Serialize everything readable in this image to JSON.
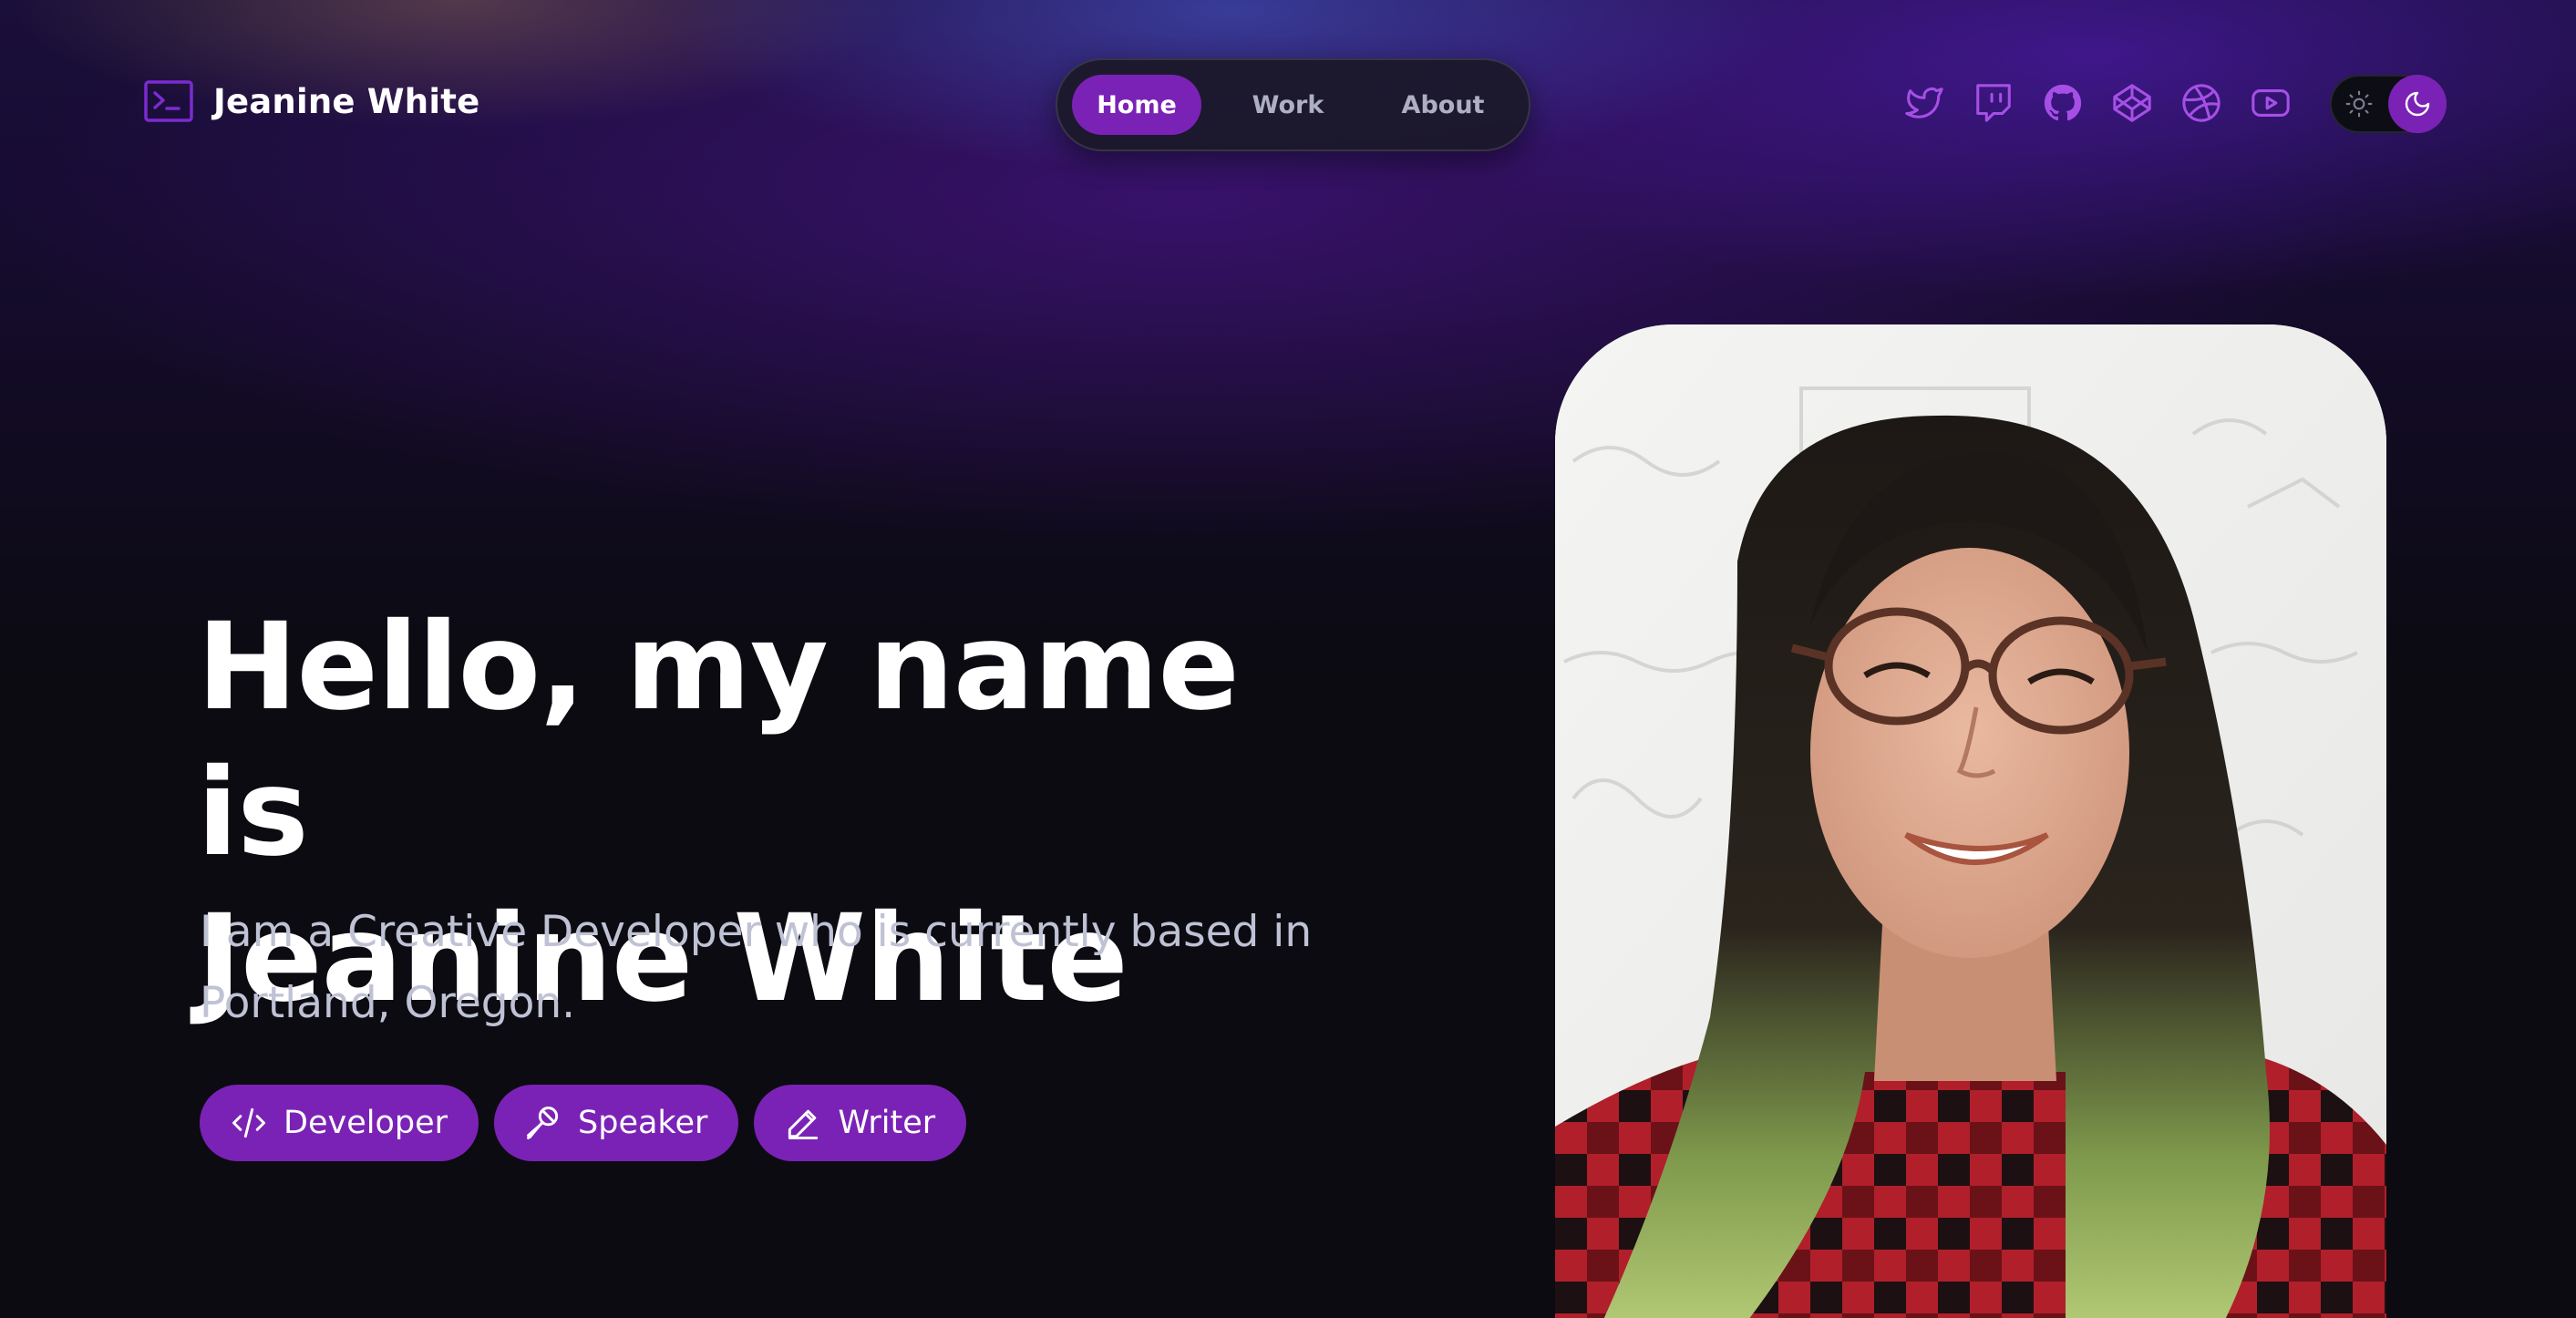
{
  "site": {
    "name": "Jeanine White",
    "logo_icon": "terminal-icon"
  },
  "nav": {
    "items": [
      {
        "label": "Home",
        "active": true
      },
      {
        "label": "Work",
        "active": false
      },
      {
        "label": "About",
        "active": false
      }
    ]
  },
  "social": [
    {
      "icon": "twitter-icon"
    },
    {
      "icon": "twitch-icon"
    },
    {
      "icon": "github-icon"
    },
    {
      "icon": "codepen-icon"
    },
    {
      "icon": "dribbble-icon"
    },
    {
      "icon": "youtube-icon"
    }
  ],
  "theme": {
    "mode": "dark",
    "icons": [
      "sun-icon",
      "moon-icon"
    ]
  },
  "hero": {
    "title_line1": "Hello, my name is",
    "title_line2": "Jeanine White",
    "subtitle": "I am a Creative Developer who is currently based in Portland, Oregon.",
    "tags": [
      {
        "label": "Developer",
        "icon": "code-icon"
      },
      {
        "label": "Speaker",
        "icon": "microphone-icon"
      },
      {
        "label": "Writer",
        "icon": "pencil-icon"
      }
    ]
  },
  "colors": {
    "accent": "#7b22b6",
    "icon_purple": "#a64fe6",
    "background": "#0b0b11",
    "subtitle_text": "#bfc2d4"
  }
}
